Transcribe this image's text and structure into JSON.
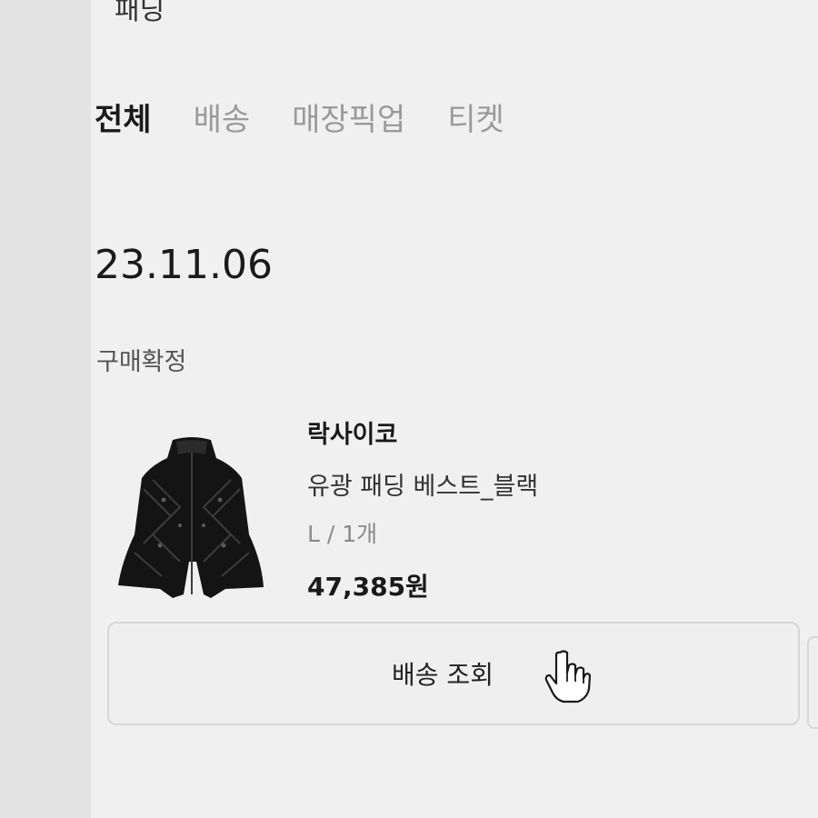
{
  "search": {
    "query": "패딩"
  },
  "tabs": [
    {
      "label": "전체",
      "active": true
    },
    {
      "label": "배송",
      "active": false
    },
    {
      "label": "매장픽업",
      "active": false
    },
    {
      "label": "티켓",
      "active": false
    }
  ],
  "order": {
    "date": "23.11.06",
    "status": "구매확정",
    "item": {
      "brand": "락사이코",
      "name": "유광 패딩 베스트_블랙",
      "option": "L / 1개",
      "price": "47,385원"
    },
    "actions": {
      "track_label": "배송 조회"
    }
  },
  "icons": {
    "cursor": "hand-pointer-icon",
    "thumbnail": "black-padded-vest"
  },
  "colors": {
    "active_tab": "#1a1a1a",
    "inactive_tab": "#9a9a9a",
    "background": "#f0f0f0"
  }
}
